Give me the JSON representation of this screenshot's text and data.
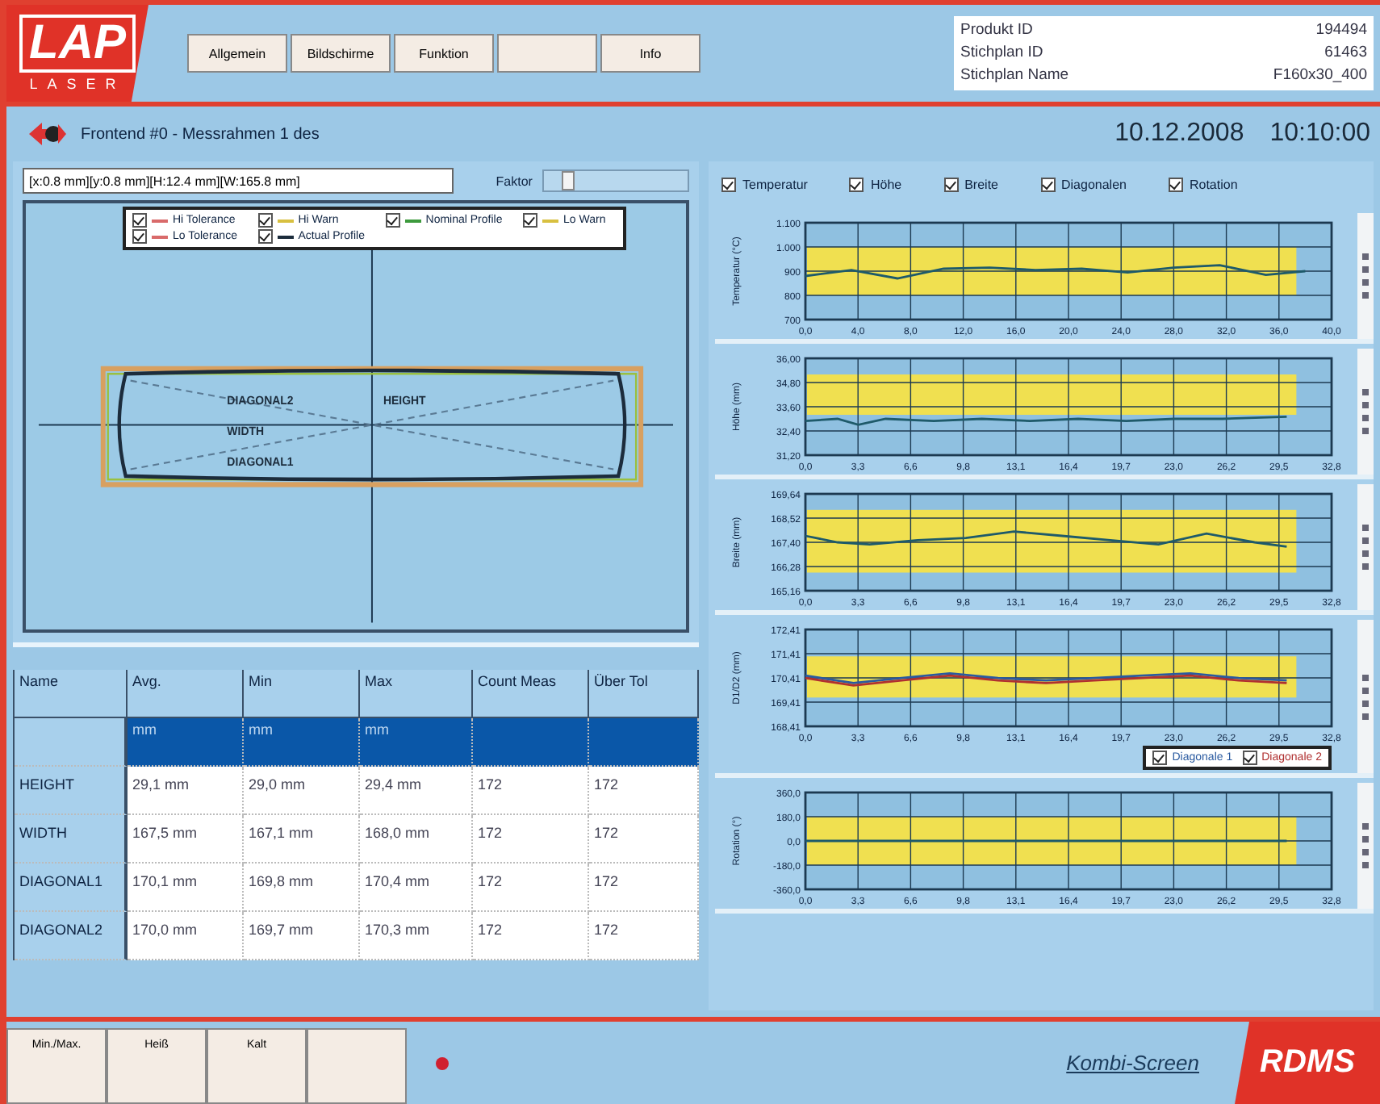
{
  "header": {
    "logo": {
      "mark": "LAP",
      "sub": "LASER"
    },
    "menu": [
      {
        "kind": "label",
        "label": "Allgemein"
      },
      {
        "kind": "label",
        "label": "Bildschirme"
      },
      {
        "kind": "label",
        "label": "Funktion"
      },
      {
        "kind": "blank"
      },
      {
        "kind": "label",
        "label": "Info"
      }
    ],
    "product_info": [
      {
        "label": "Produkt ID",
        "value": "194494"
      },
      {
        "label": "Stichplan ID",
        "value": "61463"
      },
      {
        "label": "Stichplan Name",
        "value": "F160x30_400"
      }
    ]
  },
  "title_bar": {
    "title": "Frontend #0 - Messrahmen 1 des",
    "date": "10.12.2008",
    "time": "10:10:00"
  },
  "profile": {
    "value": "[x:0.8 mm][y:0.8 mm][H:12.4 mm][W:165.8 mm]",
    "factor_label": "Faktor",
    "factor": {
      "level": 0.12
    },
    "legend": [
      {
        "label": "Hi Tolerance",
        "checked": true,
        "color": "#d96a6a"
      },
      {
        "label": "Hi Warn",
        "checked": true,
        "color": "#d8c040"
      },
      {
        "label": "Nominal Profile",
        "checked": true,
        "color": "#3d9a3d"
      },
      {
        "label": "Lo Warn",
        "checked": true,
        "color": "#d8c040"
      },
      {
        "label": "Lo Tolerance",
        "checked": true,
        "color": "#d96a6a"
      },
      {
        "label": "Actual Profile",
        "checked": true,
        "color": "#1c2c3c"
      }
    ],
    "labels": [
      "DIAGONAL2",
      "HEIGHT",
      "WIDTH",
      "DIAGONAL1"
    ]
  },
  "table": {
    "columns": [
      "Name",
      "Avg.",
      "Min",
      "Max",
      "Count Meas",
      "Über Tol"
    ],
    "rows": [
      {
        "cells": [
          "",
          "mm",
          "mm",
          "mm",
          "",
          ""
        ],
        "selected": true
      },
      {
        "cells": [
          "HEIGHT",
          "29,1 mm",
          "29,0 mm",
          "29,4 mm",
          "172",
          "172"
        ],
        "selected": false
      },
      {
        "cells": [
          "WIDTH",
          "167,5 mm",
          "167,1 mm",
          "168,0 mm",
          "172",
          "172"
        ],
        "selected": false
      },
      {
        "cells": [
          "DIAGONAL1",
          "170,1 mm",
          "169,8 mm",
          "170,4 mm",
          "172",
          "172"
        ],
        "selected": false
      },
      {
        "cells": [
          "DIAGONAL2",
          "170,0 mm",
          "169,7 mm",
          "170,3 mm",
          "172",
          "172"
        ],
        "selected": false
      }
    ]
  },
  "chart_toggles": [
    {
      "label": "Temperatur",
      "checked": true
    },
    {
      "label": "Höhe",
      "checked": true
    },
    {
      "label": "Breite",
      "checked": true
    },
    {
      "label": "Diagonalen",
      "checked": true
    },
    {
      "label": "Rotation",
      "checked": true
    }
  ],
  "charts": [
    {
      "chart_data": {
        "type": "line",
        "ylabel": "Temperatur (°C)",
        "xlim": [
          0,
          40
        ],
        "ylim": [
          700,
          1100
        ],
        "xticks": [
          {
            "value": 0,
            "label": "0,0"
          },
          {
            "value": 4,
            "label": "4,0"
          },
          {
            "value": 8,
            "label": "8,0"
          },
          {
            "value": 12,
            "label": "12,0"
          },
          {
            "value": 16,
            "label": "16,0"
          },
          {
            "value": 20,
            "label": "20,0"
          },
          {
            "value": 24,
            "label": "24,0"
          },
          {
            "value": 28,
            "label": "28,0"
          },
          {
            "value": 32,
            "label": "32,0"
          },
          {
            "value": 36,
            "label": "36,0"
          },
          {
            "value": 40,
            "label": "40,0"
          }
        ],
        "yticks": [
          {
            "value": 700,
            "label": "700"
          },
          {
            "value": 800,
            "label": "800"
          },
          {
            "value": 900,
            "label": "900"
          },
          {
            "value": 1000,
            "label": "1.000"
          },
          {
            "value": 1100,
            "label": "1.100"
          }
        ],
        "x": [
          0,
          3.5,
          7,
          10.5,
          14,
          17.5,
          21,
          24.5,
          28,
          31.5,
          35,
          38
        ],
        "series": [
          {
            "color": "#1e5a6a",
            "values": [
              880,
              905,
              870,
              910,
              915,
              905,
              910,
              895,
              915,
              925,
              885,
              900
            ]
          }
        ],
        "grid": true,
        "bands": [
          {
            "axis": "y",
            "from": 800,
            "to": 1000
          }
        ]
      }
    },
    {
      "chart_data": {
        "type": "line",
        "ylabel": "Höhe (mm)",
        "xlim": [
          0,
          32.8
        ],
        "ylim": [
          31.2,
          36.0
        ],
        "xticks": [
          {
            "value": 0,
            "label": "0,0"
          },
          {
            "value": 3.28,
            "label": "3,3"
          },
          {
            "value": 6.56,
            "label": "6,6"
          },
          {
            "value": 9.84,
            "label": "9,8"
          },
          {
            "value": 13.12,
            "label": "13,1"
          },
          {
            "value": 16.4,
            "label": "16,4"
          },
          {
            "value": 19.68,
            "label": "19,7"
          },
          {
            "value": 22.96,
            "label": "23,0"
          },
          {
            "value": 26.24,
            "label": "26,2"
          },
          {
            "value": 29.52,
            "label": "29,5"
          },
          {
            "value": 32.8,
            "label": "32,8"
          }
        ],
        "yticks": [
          {
            "value": 31.2,
            "label": "31,20"
          },
          {
            "value": 32.4,
            "label": "32,40"
          },
          {
            "value": 33.6,
            "label": "33,60"
          },
          {
            "value": 34.8,
            "label": "34,80"
          },
          {
            "value": 36.0,
            "label": "36,00"
          }
        ],
        "x": [
          0,
          2,
          3.3,
          5,
          8,
          11,
          14,
          17,
          20,
          23,
          26,
          30
        ],
        "series": [
          {
            "color": "#1e5a6a",
            "values": [
              32.9,
              33.0,
              32.7,
              33.0,
              32.9,
              33.0,
              32.9,
              33.0,
              32.9,
              33.0,
              33.0,
              33.1
            ]
          }
        ],
        "grid": true,
        "bands": [
          {
            "axis": "y",
            "from": 33.2,
            "to": 35.2
          }
        ]
      }
    },
    {
      "chart_data": {
        "type": "line",
        "ylabel": "Breite (mm)",
        "xlim": [
          0,
          32.8
        ],
        "ylim": [
          165.16,
          169.64
        ],
        "xticks": [
          {
            "value": 0,
            "label": "0,0"
          },
          {
            "value": 3.28,
            "label": "3,3"
          },
          {
            "value": 6.56,
            "label": "6,6"
          },
          {
            "value": 9.84,
            "label": "9,8"
          },
          {
            "value": 13.12,
            "label": "13,1"
          },
          {
            "value": 16.4,
            "label": "16,4"
          },
          {
            "value": 19.68,
            "label": "19,7"
          },
          {
            "value": 22.96,
            "label": "23,0"
          },
          {
            "value": 26.24,
            "label": "26,2"
          },
          {
            "value": 29.52,
            "label": "29,5"
          },
          {
            "value": 32.8,
            "label": "32,8"
          }
        ],
        "yticks": [
          {
            "value": 165.16,
            "label": "165,16"
          },
          {
            "value": 166.28,
            "label": "166,28"
          },
          {
            "value": 167.4,
            "label": "167,40"
          },
          {
            "value": 168.52,
            "label": "168,52"
          },
          {
            "value": 169.64,
            "label": "169,64"
          }
        ],
        "x": [
          0,
          2,
          4,
          7,
          10,
          13,
          16,
          19,
          22,
          25,
          28,
          30
        ],
        "series": [
          {
            "color": "#1e5a6a",
            "values": [
              167.7,
              167.4,
              167.3,
              167.5,
              167.6,
              167.9,
              167.7,
              167.5,
              167.3,
              167.8,
              167.4,
              167.2
            ]
          }
        ],
        "grid": true,
        "bands": [
          {
            "axis": "y",
            "from": 166.0,
            "to": 168.9
          }
        ]
      }
    },
    {
      "chart_data": {
        "type": "line",
        "ylabel": "D1/D2 (mm)",
        "xlim": [
          0,
          32.8
        ],
        "ylim": [
          168.41,
          172.41
        ],
        "xticks": [
          {
            "value": 0,
            "label": "0,0"
          },
          {
            "value": 3.28,
            "label": "3,3"
          },
          {
            "value": 6.56,
            "label": "6,6"
          },
          {
            "value": 9.84,
            "label": "9,8"
          },
          {
            "value": 13.12,
            "label": "13,1"
          },
          {
            "value": 16.4,
            "label": "16,4"
          },
          {
            "value": 19.68,
            "label": "19,7"
          },
          {
            "value": 22.96,
            "label": "23,0"
          },
          {
            "value": 26.24,
            "label": "26,2"
          },
          {
            "value": 29.52,
            "label": "29,5"
          },
          {
            "value": 32.8,
            "label": "32,8"
          }
        ],
        "yticks": [
          {
            "value": 168.41,
            "label": "168,41"
          },
          {
            "value": 169.41,
            "label": "169,41"
          },
          {
            "value": 170.41,
            "label": "170,41"
          },
          {
            "value": 171.41,
            "label": "171,41"
          },
          {
            "value": 172.41,
            "label": "172,41"
          }
        ],
        "x": [
          0,
          3,
          6,
          9,
          12,
          15,
          18,
          21,
          24,
          27,
          30
        ],
        "series": [
          {
            "name": "Diagonale 1",
            "color": "#2a5aa0",
            "values": [
              170.5,
              170.2,
              170.4,
              170.6,
              170.4,
              170.3,
              170.4,
              170.5,
              170.6,
              170.4,
              170.3
            ]
          },
          {
            "name": "Diagonale 2",
            "color": "#b03030",
            "values": [
              170.4,
              170.1,
              170.3,
              170.5,
              170.3,
              170.2,
              170.3,
              170.4,
              170.5,
              170.3,
              170.2
            ]
          }
        ],
        "grid": true,
        "bands": [
          {
            "axis": "y",
            "from": 169.6,
            "to": 171.3
          }
        ]
      },
      "legend": [
        {
          "checked": true
        },
        {
          "checked": true
        }
      ]
    },
    {
      "chart_data": {
        "type": "line",
        "ylabel": "Rotation (°)",
        "xlim": [
          0,
          32.8
        ],
        "ylim": [
          -360,
          360
        ],
        "xticks": [
          {
            "value": 0,
            "label": "0,0"
          },
          {
            "value": 3.28,
            "label": "3,3"
          },
          {
            "value": 6.56,
            "label": "6,6"
          },
          {
            "value": 9.84,
            "label": "9,8"
          },
          {
            "value": 13.12,
            "label": "13,1"
          },
          {
            "value": 16.4,
            "label": "16,4"
          },
          {
            "value": 19.68,
            "label": "19,7"
          },
          {
            "value": 22.96,
            "label": "23,0"
          },
          {
            "value": 26.24,
            "label": "26,2"
          },
          {
            "value": 29.52,
            "label": "29,5"
          },
          {
            "value": 32.8,
            "label": "32,8"
          }
        ],
        "yticks": [
          {
            "value": -360,
            "label": "-360,0"
          },
          {
            "value": -180,
            "label": "-180,0"
          },
          {
            "value": 0,
            "label": "0,0"
          },
          {
            "value": 180,
            "label": "180,0"
          },
          {
            "value": 360,
            "label": "360,0"
          }
        ],
        "x": [
          0,
          30
        ],
        "series": [
          {
            "color": "#1e5a6a",
            "values": [
              0,
              0
            ]
          }
        ],
        "grid": true,
        "bands": [
          {
            "axis": "y",
            "from": -180,
            "to": 180
          }
        ]
      }
    }
  ],
  "footer": {
    "buttons": [
      {
        "kind": "label",
        "label": "Min./Max."
      },
      {
        "kind": "label",
        "label": "Heiß"
      },
      {
        "kind": "label",
        "label": "Kalt"
      },
      {
        "kind": "blank"
      }
    ],
    "status_led": {
      "on": true
    },
    "link": "Kombi-Screen",
    "brand": "RDMS"
  }
}
